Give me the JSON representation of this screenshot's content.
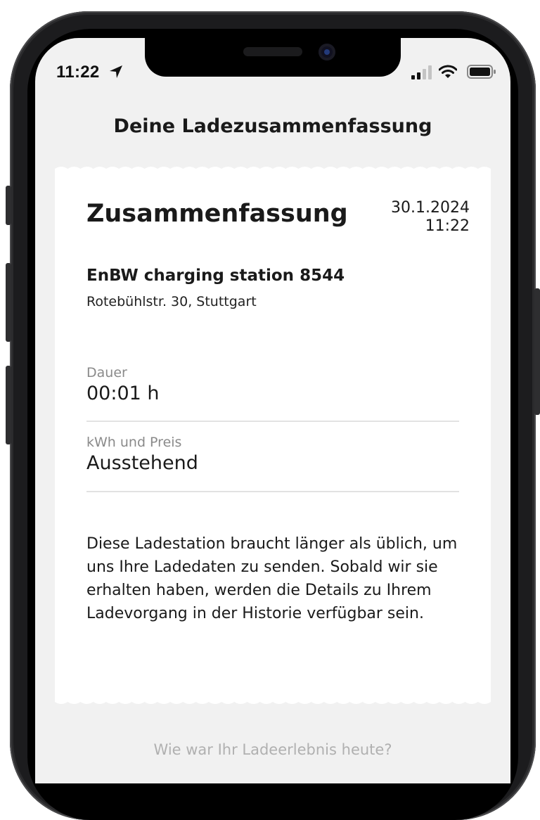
{
  "status_bar": {
    "time": "11:22",
    "location_icon": "location-arrow-icon",
    "signal_icon": "cellular-signal-icon",
    "wifi_icon": "wifi-icon",
    "battery_icon": "battery-icon"
  },
  "header": {
    "title": "Deine Ladezusammenfassung"
  },
  "summary": {
    "title": "Zusammenfassung",
    "date": "30.1.2024",
    "time": "11:22",
    "station_name": "EnBW charging station 8544",
    "station_address": "Rotebühlstr. 30, Stuttgart",
    "duration_label": "Dauer",
    "duration_value": "00:01 h",
    "energy_label": "kWh und Preis",
    "energy_value": "Ausstehend",
    "notice": "Diese Ladestation braucht länger als üblich, um uns Ihre Ladedaten zu senden. Sobald wir sie erhalten haben, werden die Details zu Ihrem Ladevorgang in der Historie verfügbar sein."
  },
  "footer": {
    "question": "Wie war Ihr Ladeerlebnis heute?"
  },
  "colors": {
    "background": "#f1f1f1",
    "card": "#ffffff",
    "text": "#1a1a1a",
    "muted": "#8a8a8a"
  }
}
